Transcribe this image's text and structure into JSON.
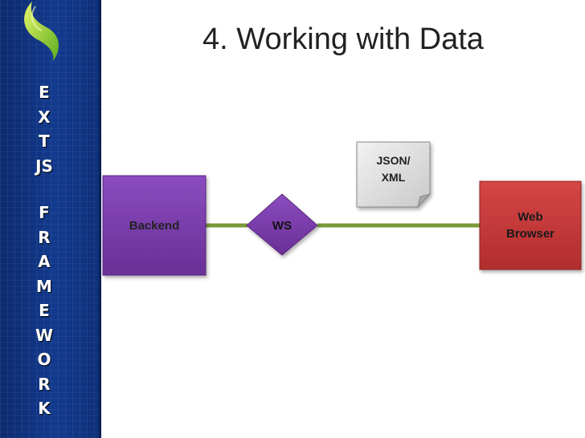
{
  "sidebar": {
    "word1": [
      "E",
      "X",
      "T",
      "JS"
    ],
    "word2": [
      "F",
      "R",
      "A",
      "M",
      "E",
      "W",
      "O",
      "R",
      "K"
    ],
    "logo_icon": "leaf-swirl-icon"
  },
  "title": "4. Working with Data",
  "diagram": {
    "backend": {
      "label": "Backend",
      "color": "#7a3fa6"
    },
    "ws": {
      "label": "WS",
      "color": "#6b3a9a"
    },
    "payload": {
      "line1": "JSON/",
      "line2": "XML"
    },
    "browser": {
      "line1": "Web",
      "line2": "Browser",
      "color": "#c43a3a"
    },
    "connector_color": "#7a9a3a"
  }
}
